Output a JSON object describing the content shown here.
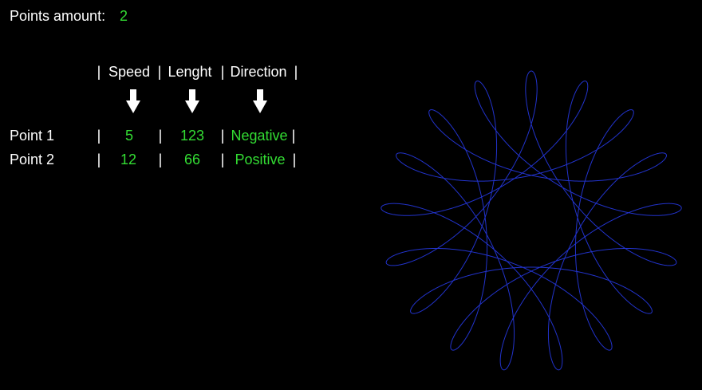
{
  "header": {
    "points_label": "Points amount:",
    "points_value": "2"
  },
  "table": {
    "header_segments": {
      "sep0": "|",
      "speed": "Speed",
      "sep1": "|",
      "length": "Lenght",
      "sep2": "|",
      "direction": "Direction",
      "sep3": "|"
    },
    "arrows": [
      "down-arrow-icon",
      "down-arrow-icon",
      "down-arrow-icon"
    ],
    "rows": [
      {
        "name": "Point 1",
        "sep_a": "|",
        "speed": "5",
        "sep_b": "|",
        "length": "123",
        "sep_c": "|",
        "direction": "Negative",
        "sep_d": "|"
      },
      {
        "name": "Point 2",
        "sep_a": "|",
        "speed": "12",
        "sep_b": "|",
        "length": "66",
        "sep_c": "|",
        "direction": "Positive",
        "sep_d": "|"
      }
    ]
  },
  "colors": {
    "background": "#000000",
    "text": "#ffffff",
    "value": "#33dd33",
    "curve": "#2233cc"
  }
}
